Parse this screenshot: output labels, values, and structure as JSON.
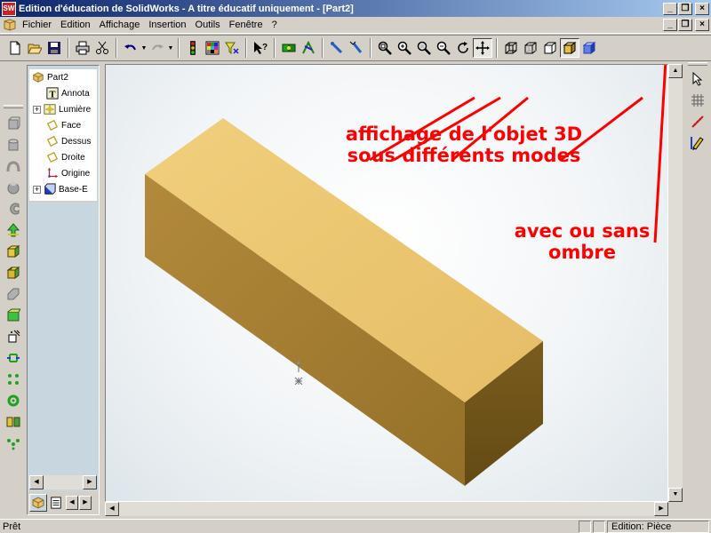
{
  "window": {
    "title": "Edition d'éducation de SolidWorks - A titre éducatif uniquement - [Part2]",
    "app_icon": "SW",
    "buttons": [
      "minimize",
      "restore",
      "close"
    ]
  },
  "menu": {
    "items": [
      "Fichier",
      "Edition",
      "Affichage",
      "Insertion",
      "Outils",
      "Fenêtre",
      "?"
    ]
  },
  "toolbar": {
    "groups": [
      [
        "new-icon",
        "open-icon",
        "save-icon"
      ],
      [
        "print-icon",
        "cut-icon"
      ],
      [
        "undo-icon",
        "redo-icon"
      ],
      [
        "traffic-light-icon",
        "grid-color-icon",
        "filter-icon",
        "whats-this-icon"
      ],
      [
        "rebuild-icon",
        "sketch-icon"
      ],
      [
        "select-icon",
        "select-filter-icon"
      ],
      [
        "zoom-fit-icon",
        "zoom-in-icon",
        "zoom-window-icon",
        "zoom-out-icon",
        "rotate-icon",
        "pan-icon"
      ],
      [
        "wireframe-icon",
        "hidden-lines-gray-icon",
        "hidden-lines-removed-icon",
        "shaded-icon",
        "shadow-icon"
      ]
    ]
  },
  "tree": {
    "root": "Part2",
    "items": [
      {
        "label": "Annota",
        "icon": "annotations-icon",
        "expandable": false
      },
      {
        "label": "Lumière",
        "icon": "lights-icon",
        "expandable": true
      },
      {
        "label": "Face",
        "icon": "plane-icon",
        "expandable": false
      },
      {
        "label": "Dessus",
        "icon": "plane-icon",
        "expandable": false
      },
      {
        "label": "Droite",
        "icon": "plane-icon",
        "expandable": false
      },
      {
        "label": "Origine",
        "icon": "origin-icon",
        "expandable": false
      },
      {
        "label": "Base-E",
        "icon": "extrude-icon",
        "expandable": true
      }
    ]
  },
  "annotations": {
    "modes_line1": "affichage de l'objet 3D",
    "modes_line2": "sous différents modes",
    "shadow_line1": "avec ou sans",
    "shadow_line2": "ombre",
    "color": "#ff0000"
  },
  "model": {
    "top_color": "#e8c06a",
    "front_color": "#a47c32",
    "side_color": "#6e5218"
  },
  "status": {
    "left": "Prêt",
    "mode": "Edition: Pièce"
  }
}
